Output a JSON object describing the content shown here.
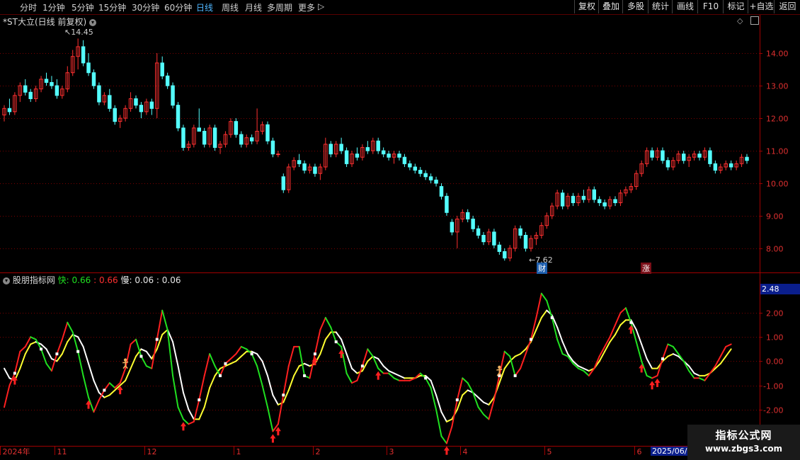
{
  "toolbar": {
    "timeframes": [
      "分时",
      "1分钟",
      "5分钟",
      "15分钟",
      "30分钟",
      "60分钟",
      "日线",
      "周线",
      "月线",
      "多周期",
      "更多"
    ],
    "active": "日线",
    "more_arrow": "▷",
    "right_buttons": [
      "复权",
      "叠加",
      "多股",
      "统计",
      "画线",
      "F10",
      "标记",
      "+自选",
      "返回"
    ]
  },
  "price_panel": {
    "title": "*ST大立(日线 前复权)",
    "y_ticks": [
      "14.00",
      "13.00",
      "12.00",
      "11.00",
      "10.00",
      "9.00",
      "8.00"
    ],
    "high_label": "14.45",
    "low_label": "7.62",
    "marker_finance": "财",
    "marker_up": "涨"
  },
  "indicator_panel": {
    "name": "股朋指标网",
    "fast_label": "快:",
    "fast_value_1": "0.66",
    "fast_value_2": ": 0.66",
    "slow_label": "慢:",
    "slow_value_1": "0.06",
    "slow_value_2": ": 0.06",
    "current_value": "2.48",
    "y_ticks": [
      "2.00",
      "1.00",
      "0.00",
      "-1.00",
      "-2.00"
    ]
  },
  "time_axis": {
    "labels": [
      "2024年",
      "11",
      "12",
      "1",
      "2",
      "3",
      "4",
      "5",
      "6"
    ],
    "cursor_label": "2025/06/"
  },
  "watermark": {
    "line1": "指标公式网",
    "line2": "www.zbgs3.com"
  },
  "colors": {
    "up": "#ff3030",
    "down": "#54ffff",
    "fast_up": "#ff2020",
    "fast_down": "#20e020",
    "slow_up": "#ffff30",
    "slow_down": "#ffffff",
    "grid": "#7a0000",
    "axis_text": "#e03030"
  },
  "chart_data": {
    "type": "candlestick",
    "ylim": [
      7.3,
      14.7
    ],
    "candles": [
      [
        12.1,
        12.4,
        11.9,
        12.3
      ],
      [
        12.3,
        12.6,
        12.1,
        12.2
      ],
      [
        12.2,
        12.8,
        12.1,
        12.7
      ],
      [
        12.7,
        13.1,
        12.5,
        13.0
      ],
      [
        13.0,
        13.2,
        12.7,
        12.8
      ],
      [
        12.8,
        12.9,
        12.5,
        12.6
      ],
      [
        12.6,
        13.0,
        12.5,
        12.9
      ],
      [
        12.9,
        13.3,
        12.8,
        13.2
      ],
      [
        13.2,
        13.4,
        13.0,
        13.1
      ],
      [
        13.1,
        13.3,
        12.9,
        13.0
      ],
      [
        13.0,
        13.2,
        12.6,
        12.7
      ],
      [
        12.7,
        13.0,
        12.6,
        12.9
      ],
      [
        12.9,
        13.6,
        12.8,
        13.4
      ],
      [
        13.4,
        14.1,
        13.3,
        13.9
      ],
      [
        13.9,
        14.45,
        13.5,
        14.2
      ],
      [
        14.2,
        14.4,
        13.6,
        13.7
      ],
      [
        13.7,
        14.0,
        13.3,
        13.4
      ],
      [
        13.4,
        13.5,
        12.9,
        13.0
      ],
      [
        13.0,
        13.1,
        12.4,
        12.5
      ],
      [
        12.5,
        12.8,
        12.4,
        12.7
      ],
      [
        12.7,
        12.9,
        12.2,
        12.3
      ],
      [
        12.3,
        12.4,
        11.8,
        11.9
      ],
      [
        11.9,
        12.1,
        11.7,
        12.0
      ],
      [
        12.0,
        12.4,
        11.9,
        12.3
      ],
      [
        12.3,
        12.8,
        12.2,
        12.6
      ],
      [
        12.6,
        12.7,
        12.3,
        12.4
      ],
      [
        12.4,
        12.5,
        12.0,
        12.2
      ],
      [
        12.2,
        12.6,
        12.1,
        12.5
      ],
      [
        12.5,
        12.6,
        12.1,
        12.3
      ],
      [
        12.3,
        14.0,
        12.0,
        13.7
      ],
      [
        13.7,
        13.9,
        13.2,
        13.3
      ],
      [
        13.3,
        13.4,
        12.9,
        13.0
      ],
      [
        13.0,
        13.1,
        12.3,
        12.4
      ],
      [
        12.4,
        12.5,
        11.6,
        11.7
      ],
      [
        11.7,
        11.8,
        11.0,
        11.1
      ],
      [
        11.1,
        11.3,
        11.0,
        11.2
      ],
      [
        11.2,
        11.8,
        11.1,
        11.7
      ],
      [
        11.7,
        12.3,
        11.6,
        11.6
      ],
      [
        11.6,
        11.7,
        11.1,
        11.2
      ],
      [
        11.2,
        11.8,
        11.1,
        11.7
      ],
      [
        11.7,
        11.8,
        11.0,
        11.1
      ],
      [
        11.1,
        11.3,
        10.9,
        11.2
      ],
      [
        11.2,
        11.6,
        11.1,
        11.5
      ],
      [
        11.5,
        12.0,
        11.4,
        11.9
      ],
      [
        11.9,
        12.0,
        11.4,
        11.5
      ],
      [
        11.5,
        11.6,
        11.1,
        11.2
      ],
      [
        11.2,
        11.5,
        11.1,
        11.4
      ],
      [
        11.4,
        11.5,
        11.2,
        11.3
      ],
      [
        11.3,
        12.3,
        11.2,
        11.6
      ],
      [
        11.6,
        11.9,
        11.5,
        11.8
      ],
      [
        11.8,
        11.9,
        11.2,
        11.3
      ],
      [
        11.3,
        11.4,
        10.8,
        10.9
      ],
      [
        10.9,
        11.0,
        10.8,
        10.9
      ],
      [
        10.2,
        10.3,
        9.7,
        9.8
      ],
      [
        9.8,
        10.6,
        9.7,
        10.5
      ],
      [
        10.5,
        10.8,
        10.4,
        10.7
      ],
      [
        10.7,
        10.9,
        10.5,
        10.6
      ],
      [
        10.6,
        10.7,
        10.3,
        10.4
      ],
      [
        10.4,
        10.6,
        10.3,
        10.5
      ],
      [
        10.5,
        10.6,
        10.2,
        10.3
      ],
      [
        10.3,
        10.6,
        10.1,
        10.5
      ],
      [
        10.5,
        11.4,
        10.4,
        11.2
      ],
      [
        11.2,
        11.3,
        10.8,
        10.9
      ],
      [
        10.9,
        11.3,
        10.8,
        11.2
      ],
      [
        11.2,
        11.4,
        10.9,
        11.0
      ],
      [
        11.0,
        11.1,
        10.5,
        10.6
      ],
      [
        10.6,
        11.0,
        10.5,
        10.9
      ],
      [
        10.9,
        11.1,
        10.7,
        10.8
      ],
      [
        10.8,
        11.2,
        10.7,
        11.1
      ],
      [
        11.1,
        11.3,
        10.9,
        11.0
      ],
      [
        11.0,
        11.4,
        10.9,
        11.3
      ],
      [
        11.3,
        11.4,
        10.9,
        11.0
      ],
      [
        11.0,
        11.1,
        10.8,
        10.9
      ],
      [
        10.9,
        11.0,
        10.7,
        10.8
      ],
      [
        10.8,
        11.0,
        10.6,
        10.9
      ],
      [
        10.9,
        11.0,
        10.7,
        10.8
      ],
      [
        10.8,
        10.9,
        10.5,
        10.6
      ],
      [
        10.6,
        10.7,
        10.4,
        10.5
      ],
      [
        10.5,
        10.6,
        10.3,
        10.4
      ],
      [
        10.4,
        10.5,
        10.2,
        10.3
      ],
      [
        10.3,
        10.4,
        10.1,
        10.2
      ],
      [
        10.2,
        10.3,
        10.0,
        10.1
      ],
      [
        10.1,
        10.2,
        9.9,
        10.0
      ],
      [
        9.9,
        10.0,
        9.5,
        9.6
      ],
      [
        9.6,
        9.7,
        9.0,
        9.1
      ],
      [
        8.8,
        8.9,
        8.4,
        8.5
      ],
      [
        8.5,
        9.0,
        8.0,
        8.9
      ],
      [
        8.9,
        9.2,
        8.8,
        9.1
      ],
      [
        9.1,
        9.2,
        8.8,
        8.9
      ],
      [
        8.9,
        9.0,
        8.5,
        8.6
      ],
      [
        8.6,
        8.7,
        8.3,
        8.4
      ],
      [
        8.4,
        8.5,
        8.1,
        8.2
      ],
      [
        8.2,
        8.6,
        8.1,
        8.5
      ],
      [
        8.5,
        8.6,
        8.0,
        8.1
      ],
      [
        8.1,
        8.2,
        7.8,
        7.9
      ],
      [
        7.9,
        8.0,
        7.62,
        7.7
      ],
      [
        7.7,
        8.1,
        7.6,
        8.0
      ],
      [
        8.0,
        8.7,
        7.9,
        8.6
      ],
      [
        8.6,
        8.7,
        8.3,
        8.4
      ],
      [
        8.4,
        8.5,
        7.9,
        8.0
      ],
      [
        8.0,
        8.4,
        7.9,
        8.3
      ],
      [
        8.3,
        8.5,
        8.1,
        8.4
      ],
      [
        8.4,
        8.8,
        8.3,
        8.7
      ],
      [
        8.7,
        9.1,
        8.6,
        9.0
      ],
      [
        9.0,
        9.4,
        8.9,
        9.3
      ],
      [
        9.3,
        9.8,
        9.2,
        9.7
      ],
      [
        9.7,
        9.8,
        9.2,
        9.3
      ],
      [
        9.3,
        9.7,
        9.2,
        9.6
      ],
      [
        9.6,
        9.7,
        9.3,
        9.4
      ],
      [
        9.4,
        9.7,
        9.3,
        9.6
      ],
      [
        9.6,
        9.8,
        9.4,
        9.5
      ],
      [
        9.5,
        9.9,
        9.4,
        9.8
      ],
      [
        9.8,
        9.9,
        9.4,
        9.5
      ],
      [
        9.5,
        9.6,
        9.3,
        9.4
      ],
      [
        9.4,
        9.5,
        9.2,
        9.3
      ],
      [
        9.3,
        9.6,
        9.2,
        9.5
      ],
      [
        9.5,
        9.6,
        9.3,
        9.4
      ],
      [
        9.4,
        9.8,
        9.3,
        9.7
      ],
      [
        9.7,
        9.9,
        9.6,
        9.8
      ],
      [
        9.8,
        10.0,
        9.7,
        9.9
      ],
      [
        9.9,
        10.4,
        9.8,
        10.3
      ],
      [
        10.3,
        10.7,
        10.2,
        10.6
      ],
      [
        10.6,
        11.1,
        10.5,
        11.0
      ],
      [
        11.0,
        11.1,
        10.7,
        10.8
      ],
      [
        10.8,
        11.1,
        10.7,
        11.0
      ],
      [
        11.0,
        11.1,
        10.6,
        10.7
      ],
      [
        10.7,
        10.8,
        10.4,
        10.5
      ],
      [
        10.5,
        10.8,
        10.4,
        10.7
      ],
      [
        10.7,
        11.0,
        10.6,
        10.9
      ],
      [
        10.9,
        11.0,
        10.6,
        10.7
      ],
      [
        10.7,
        10.9,
        10.5,
        10.8
      ],
      [
        10.8,
        11.0,
        10.7,
        10.9
      ],
      [
        10.9,
        11.0,
        10.7,
        10.8
      ],
      [
        10.8,
        11.1,
        10.7,
        11.0
      ],
      [
        11.0,
        11.1,
        10.5,
        10.6
      ],
      [
        10.6,
        10.7,
        10.3,
        10.4
      ],
      [
        10.4,
        10.6,
        10.3,
        10.5
      ],
      [
        10.5,
        10.7,
        10.4,
        10.6
      ],
      [
        10.6,
        10.7,
        10.4,
        10.5
      ],
      [
        10.5,
        10.7,
        10.4,
        10.6
      ],
      [
        10.6,
        10.9,
        10.5,
        10.8
      ],
      [
        10.8,
        10.9,
        10.6,
        10.7
      ]
    ],
    "indicator": {
      "ylim": [
        -3.5,
        3.2
      ],
      "fast": [
        -1.9,
        -1.0,
        -0.5,
        0.4,
        0.6,
        1.0,
        0.9,
        0.5,
        -0.1,
        -0.4,
        0.3,
        0.9,
        1.6,
        1.2,
        0.4,
        -0.6,
        -1.5,
        -2.1,
        -1.6,
        -1.2,
        -0.9,
        -1.1,
        -0.9,
        -0.3,
        0.7,
        0.9,
        0.2,
        -0.2,
        -0.3,
        0.9,
        2.1,
        1.3,
        -0.6,
        -1.9,
        -2.4,
        -2.6,
        -2.5,
        -1.6,
        -0.6,
        0.3,
        -0.2,
        -0.6,
        -0.1,
        0.1,
        0.3,
        0.6,
        0.5,
        0.3,
        -0.2,
        -1.0,
        -1.9,
        -2.9,
        -2.6,
        -1.4,
        -0.2,
        0.6,
        0.6,
        -0.6,
        -0.7,
        0.3,
        1.3,
        1.8,
        1.4,
        0.8,
        0.6,
        -0.5,
        -0.9,
        -0.8,
        -0.2,
        0.5,
        0.2,
        -0.3,
        -0.5,
        -0.5,
        -0.7,
        -0.8,
        -0.8,
        -0.8,
        -0.7,
        -0.5,
        -0.7,
        -1.1,
        -2.0,
        -3.1,
        -3.4,
        -2.7,
        -1.6,
        -0.7,
        -0.9,
        -1.3,
        -1.9,
        -2.2,
        -2.4,
        -1.6,
        -0.6,
        0.4,
        0.2,
        -0.6,
        -0.3,
        0.3,
        0.9,
        1.8,
        2.8,
        2.5,
        1.8,
        0.9,
        0.3,
        0.2,
        -0.1,
        -0.3,
        -0.4,
        -0.6,
        -0.3,
        0.2,
        0.6,
        1.0,
        1.5,
        2.0,
        2.2,
        1.6,
        0.8,
        0.0,
        -0.6,
        -0.7,
        -0.6,
        0.1,
        0.7,
        0.6,
        0.3,
        0.0,
        -0.4,
        -0.7,
        -0.7,
        -0.8,
        -0.5,
        -0.2,
        0.2,
        0.6,
        0.7
      ],
      "slow": [
        -0.3,
        -0.7,
        -0.8,
        -0.3,
        0.3,
        0.7,
        0.8,
        0.7,
        0.5,
        0.1,
        0.0,
        0.3,
        0.8,
        1.1,
        1.0,
        0.6,
        -0.1,
        -0.8,
        -1.3,
        -1.5,
        -1.4,
        -1.2,
        -1.0,
        -0.8,
        -0.3,
        0.2,
        0.5,
        0.4,
        0.1,
        0.5,
        1.1,
        1.3,
        0.8,
        -0.2,
        -1.3,
        -2.0,
        -2.4,
        -2.4,
        -1.9,
        -1.1,
        -0.6,
        -0.3,
        -0.2,
        -0.1,
        0.0,
        0.2,
        0.4,
        0.4,
        0.3,
        0.0,
        -0.6,
        -1.4,
        -1.8,
        -1.7,
        -1.2,
        -0.6,
        -0.2,
        -0.1,
        -0.2,
        -0.1,
        0.3,
        0.9,
        1.2,
        1.2,
        0.9,
        0.3,
        -0.3,
        -0.5,
        -0.4,
        0.0,
        0.2,
        0.1,
        -0.2,
        -0.4,
        -0.5,
        -0.6,
        -0.7,
        -0.7,
        -0.7,
        -0.6,
        -0.6,
        -0.8,
        -1.4,
        -2.1,
        -2.5,
        -2.4,
        -2.0,
        -1.4,
        -1.2,
        -1.3,
        -1.5,
        -1.7,
        -1.8,
        -1.5,
        -0.9,
        -0.3,
        0.0,
        0.2,
        0.3,
        0.5,
        0.8,
        1.3,
        1.8,
        2.1,
        1.9,
        1.4,
        0.8,
        0.3,
        0.0,
        -0.2,
        -0.3,
        -0.4,
        -0.3,
        0.0,
        0.4,
        0.8,
        1.1,
        1.5,
        1.7,
        1.7,
        1.3,
        0.7,
        0.1,
        -0.3,
        -0.3,
        0.0,
        0.2,
        0.3,
        0.2,
        0.0,
        -0.2,
        -0.5,
        -0.6,
        -0.6,
        -0.5,
        -0.3,
        -0.1,
        0.2,
        0.5
      ],
      "arrows_up": [
        2,
        16,
        22,
        34,
        51,
        52,
        59,
        64,
        71,
        84,
        119,
        121,
        123,
        124
      ],
      "figure_markers": [
        23,
        94
      ]
    }
  }
}
